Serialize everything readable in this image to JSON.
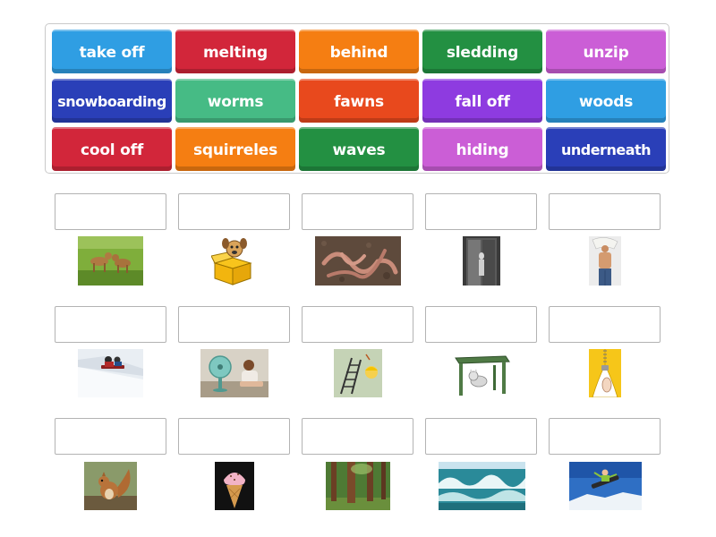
{
  "word_bank": {
    "tiles": [
      {
        "label": "take off",
        "color": "#2f9ee3"
      },
      {
        "label": "melting",
        "color": "#d2263a"
      },
      {
        "label": "behind",
        "color": "#f57e12"
      },
      {
        "label": "sledding",
        "color": "#239042"
      },
      {
        "label": "unzip",
        "color": "#cb5ed6"
      },
      {
        "label": "snowboarding",
        "color": "#2a3fb8"
      },
      {
        "label": "worms",
        "color": "#46bb85"
      },
      {
        "label": "fawns",
        "color": "#e8491d"
      },
      {
        "label": "fall off",
        "color": "#8e3be0"
      },
      {
        "label": "woods",
        "color": "#2f9ee3"
      },
      {
        "label": "cool off",
        "color": "#d2263a"
      },
      {
        "label": "squirreles",
        "color": "#f57e12"
      },
      {
        "label": "waves",
        "color": "#239042"
      },
      {
        "label": "hiding",
        "color": "#cb5ed6"
      },
      {
        "label": "underneath",
        "color": "#2a3fb8"
      }
    ]
  },
  "pictures": [
    {
      "icon": "fawns-photo"
    },
    {
      "icon": "dog-in-box-cartoon"
    },
    {
      "icon": "worms-photo"
    },
    {
      "icon": "behind-door-photo"
    },
    {
      "icon": "boy-taking-off-shirt-photo"
    },
    {
      "icon": "sledding-photo"
    },
    {
      "icon": "girl-by-fan-photo"
    },
    {
      "icon": "falling-off-ladder-cartoon"
    },
    {
      "icon": "cat-under-table-cartoon"
    },
    {
      "icon": "unzip-zipper-icon"
    },
    {
      "icon": "squirrel-photo"
    },
    {
      "icon": "melting-ice-cream-photo"
    },
    {
      "icon": "woods-forest-photo"
    },
    {
      "icon": "ocean-waves-photo"
    },
    {
      "icon": "snowboarder-photo"
    }
  ]
}
